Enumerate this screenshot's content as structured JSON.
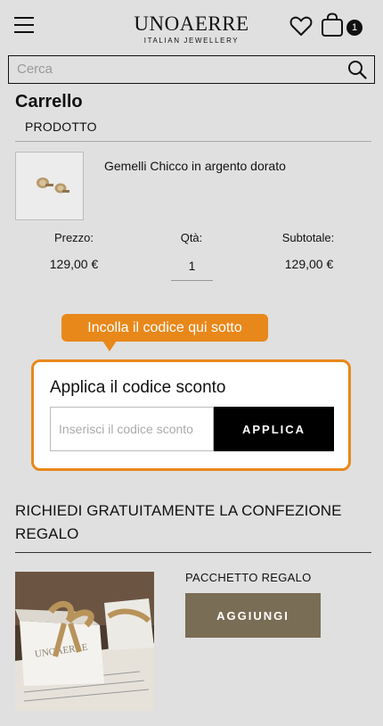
{
  "header": {
    "logo_main": "UNOAERRE",
    "logo_sub": "ITALIAN JEWELLERY",
    "cart_count": "1"
  },
  "search": {
    "placeholder": "Cerca",
    "value": ""
  },
  "cart": {
    "title": "Carrello",
    "column_label": "PRODOTTO",
    "item": {
      "name": "Gemelli Chicco in argento dorato",
      "price_label": "Prezzo:",
      "price": "129,00 €",
      "qty_label": "Qtà:",
      "qty": "1",
      "subtotal_label": "Subtotale:",
      "subtotal": "129,00 €"
    }
  },
  "tooltip": {
    "text": "Incolla il codice qui sotto"
  },
  "discount": {
    "title": "Applica il codice sconto",
    "placeholder": "Inserisci il codice sconto",
    "button": "APPLICA"
  },
  "gift": {
    "title": "RICHIEDI GRATUITAMENTE LA CONFEZIONE REGALO",
    "label": "PACCHETTO REGALO",
    "button": "AGGIUNGI",
    "box_brand": "UNOAERRE"
  },
  "colors": {
    "accent": "#e8881a",
    "button_dark": "#000000",
    "button_gift": "#7a6d55",
    "background": "#e0e0e0"
  }
}
